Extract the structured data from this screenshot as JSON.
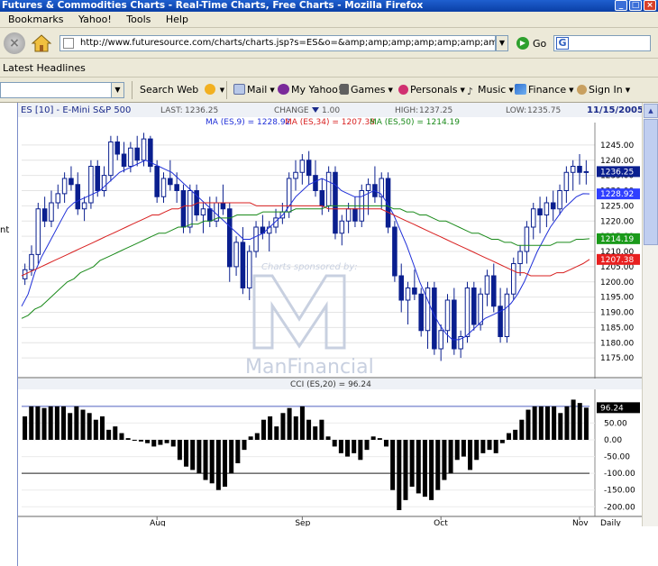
{
  "window": {
    "title": "Futures & Commodities Charts - Real-Time Charts, Free Charts - Mozilla Firefox"
  },
  "menu": [
    "Bookmarks",
    "Yahoo!",
    "Tools",
    "Help"
  ],
  "nav": {
    "url": "http://www.futuresource.com/charts/charts.jsp?s=ES&o=&amp;amp;amp;amp;amp;amp;amp;amp;amp;a=D&",
    "go_label": "Go"
  },
  "headlines_label": "Latest Headlines",
  "yahoo_toolbar": {
    "search_label": "Search Web",
    "items": [
      "Mail",
      "My Yahoo!",
      "Games",
      "Personals",
      "Music",
      "Finance",
      "Sign In"
    ]
  },
  "left_strip_text": "nt",
  "colors": {
    "candle": "#0a1f8f",
    "ma9": "#1f2fd8",
    "ma34": "#d81f1f",
    "ma50": "#1a8a1a",
    "price_tag_last": "#0a1f8f",
    "price_tag_ma9": "#2f3fff",
    "price_tag_ma34": "#e82020",
    "price_tag_ma50": "#1a9a1a",
    "cci_bar": "#000000"
  },
  "chart_header": {
    "symbol": "ES [10] - E-Mini S&P 500",
    "last_label": "LAST:",
    "last_value": "1236.25",
    "change_label": "CHANGE",
    "change_value": "1.00",
    "high_label": "HIGH:",
    "high_value": "1237.25",
    "low_label": "LOW:",
    "low_value": "1235.75",
    "date": "11/15/2005",
    "ma9_label": "MA (ES,9) = 1228.92",
    "ma34_label": "MA (ES,34) = 1207.38",
    "ma50_label": "MA (ES,50) = 1214.19"
  },
  "watermark": {
    "sponsor_text": "Charts sponsored by:",
    "brand_text": "ManFinancial"
  },
  "price_tags": {
    "last": "1236.25",
    "ma9": "1228.92",
    "ma50": "1214.19",
    "ma34": "1207.38"
  },
  "cci": {
    "label": "CCI (ES,20) = 96.24",
    "value_tag": "96.24",
    "ylim": [
      -210,
      140
    ],
    "ticks": [
      "50.00",
      "0.00",
      "-50.00",
      "-100.00",
      "-150.00",
      "-200.00"
    ],
    "tick_values": [
      50,
      0,
      -50,
      -100,
      -150,
      -200
    ],
    "reference_lines": [
      100,
      -100
    ],
    "values": [
      70,
      100,
      100,
      95,
      100,
      100,
      100,
      80,
      100,
      90,
      80,
      60,
      70,
      30,
      40,
      20,
      5,
      0,
      -5,
      -10,
      -20,
      -15,
      -10,
      -20,
      -60,
      -80,
      -90,
      -100,
      -120,
      -130,
      -150,
      -140,
      -100,
      -70,
      -30,
      10,
      20,
      60,
      70,
      40,
      80,
      95,
      70,
      100,
      60,
      40,
      60,
      10,
      -20,
      -40,
      -50,
      -40,
      -60,
      -30,
      10,
      5,
      -20,
      -150,
      -210,
      -180,
      -140,
      -160,
      -170,
      -180,
      -150,
      -120,
      -100,
      -60,
      -50,
      -90,
      -60,
      -40,
      -30,
      -40,
      -10,
      20,
      30,
      60,
      90,
      100,
      100,
      100,
      100,
      80,
      100,
      120,
      110,
      96
    ]
  },
  "chart_data": {
    "type": "candlestick",
    "title": "ES [10] - E-Mini S&P 500",
    "xlabel": "Daily",
    "x_tick_labels": [
      "Aug",
      "Sep",
      "Oct",
      "Nov"
    ],
    "x_tick_indices": [
      20,
      42,
      63,
      84
    ],
    "ylim": [
      1170,
      1250
    ],
    "y_ticks": [
      1175,
      1180,
      1185,
      1190,
      1195,
      1200,
      1205,
      1210,
      1215,
      1220,
      1225,
      1230,
      1235,
      1240,
      1245
    ],
    "grid": true,
    "series": [
      {
        "name": "ES [10]",
        "type": "candlestick",
        "ohlc": [
          [
            1201,
            1206,
            1199,
            1204
          ],
          [
            1204,
            1212,
            1202,
            1209
          ],
          [
            1209,
            1226,
            1206,
            1224
          ],
          [
            1224,
            1228,
            1218,
            1220
          ],
          [
            1220,
            1230,
            1218,
            1226
          ],
          [
            1226,
            1232,
            1224,
            1229
          ],
          [
            1229,
            1236,
            1226,
            1234
          ],
          [
            1234,
            1238,
            1230,
            1232
          ],
          [
            1232,
            1236,
            1222,
            1224
          ],
          [
            1224,
            1228,
            1220,
            1226
          ],
          [
            1226,
            1240,
            1224,
            1238
          ],
          [
            1238,
            1240,
            1228,
            1230
          ],
          [
            1230,
            1238,
            1228,
            1235
          ],
          [
            1235,
            1248,
            1233,
            1246
          ],
          [
            1246,
            1248,
            1240,
            1242
          ],
          [
            1242,
            1246,
            1236,
            1238
          ],
          [
            1238,
            1246,
            1236,
            1244
          ],
          [
            1244,
            1248,
            1238,
            1240
          ],
          [
            1240,
            1249,
            1238,
            1247
          ],
          [
            1247,
            1248,
            1236,
            1238
          ],
          [
            1238,
            1240,
            1226,
            1228
          ],
          [
            1228,
            1236,
            1226,
            1234
          ],
          [
            1234,
            1240,
            1230,
            1232
          ],
          [
            1232,
            1236,
            1226,
            1230
          ],
          [
            1230,
            1232,
            1216,
            1218
          ],
          [
            1218,
            1232,
            1216,
            1230
          ],
          [
            1230,
            1232,
            1220,
            1222
          ],
          [
            1222,
            1226,
            1216,
            1224
          ],
          [
            1224,
            1228,
            1218,
            1220
          ],
          [
            1220,
            1228,
            1218,
            1226
          ],
          [
            1226,
            1232,
            1222,
            1224
          ],
          [
            1224,
            1226,
            1200,
            1205
          ],
          [
            1205,
            1215,
            1202,
            1213
          ],
          [
            1213,
            1218,
            1196,
            1198
          ],
          [
            1198,
            1212,
            1194,
            1210
          ],
          [
            1210,
            1220,
            1208,
            1218
          ],
          [
            1218,
            1222,
            1214,
            1216
          ],
          [
            1216,
            1220,
            1210,
            1218
          ],
          [
            1218,
            1224,
            1216,
            1221
          ],
          [
            1221,
            1226,
            1219,
            1223
          ],
          [
            1223,
            1236,
            1221,
            1234
          ],
          [
            1234,
            1240,
            1230,
            1236
          ],
          [
            1236,
            1242,
            1232,
            1240
          ],
          [
            1240,
            1243,
            1232,
            1235
          ],
          [
            1235,
            1240,
            1228,
            1230
          ],
          [
            1230,
            1234,
            1222,
            1225
          ],
          [
            1225,
            1238,
            1223,
            1236
          ],
          [
            1236,
            1238,
            1214,
            1216
          ],
          [
            1216,
            1222,
            1212,
            1220
          ],
          [
            1220,
            1226,
            1216,
            1224
          ],
          [
            1224,
            1228,
            1218,
            1220
          ],
          [
            1220,
            1232,
            1218,
            1230
          ],
          [
            1230,
            1234,
            1222,
            1232
          ],
          [
            1232,
            1238,
            1226,
            1228
          ],
          [
            1228,
            1236,
            1224,
            1234
          ],
          [
            1234,
            1236,
            1216,
            1218
          ],
          [
            1218,
            1220,
            1200,
            1202
          ],
          [
            1202,
            1206,
            1190,
            1194
          ],
          [
            1194,
            1200,
            1186,
            1198
          ],
          [
            1198,
            1204,
            1194,
            1196
          ],
          [
            1196,
            1198,
            1182,
            1184
          ],
          [
            1184,
            1200,
            1178,
            1198
          ],
          [
            1198,
            1200,
            1176,
            1178
          ],
          [
            1178,
            1186,
            1174,
            1184
          ],
          [
            1184,
            1196,
            1180,
            1194
          ],
          [
            1194,
            1198,
            1176,
            1178
          ],
          [
            1178,
            1184,
            1175,
            1182
          ],
          [
            1182,
            1200,
            1180,
            1198
          ],
          [
            1198,
            1200,
            1184,
            1186
          ],
          [
            1186,
            1198,
            1184,
            1196
          ],
          [
            1196,
            1204,
            1192,
            1202
          ],
          [
            1202,
            1206,
            1190,
            1192
          ],
          [
            1192,
            1198,
            1180,
            1182
          ],
          [
            1182,
            1198,
            1180,
            1196
          ],
          [
            1196,
            1208,
            1194,
            1206
          ],
          [
            1206,
            1212,
            1202,
            1210
          ],
          [
            1210,
            1220,
            1206,
            1218
          ],
          [
            1218,
            1226,
            1214,
            1224
          ],
          [
            1224,
            1228,
            1216,
            1222
          ],
          [
            1222,
            1228,
            1218,
            1226
          ],
          [
            1226,
            1230,
            1220,
            1224
          ],
          [
            1224,
            1232,
            1222,
            1230
          ],
          [
            1230,
            1238,
            1226,
            1236
          ],
          [
            1236,
            1240,
            1230,
            1238
          ],
          [
            1238,
            1242,
            1232,
            1236
          ],
          [
            1236,
            1240,
            1232,
            1236.25
          ]
        ]
      },
      {
        "name": "MA (ES,9)",
        "type": "line",
        "values": [
          1192,
          1196,
          1203,
          1208,
          1212,
          1216,
          1220,
          1224,
          1226,
          1227,
          1228,
          1229,
          1230,
          1232,
          1234,
          1236,
          1237,
          1238,
          1239,
          1240,
          1239,
          1238,
          1237,
          1236,
          1234,
          1232,
          1230,
          1228,
          1226,
          1224,
          1222,
          1220,
          1218,
          1216,
          1214,
          1214,
          1215,
          1216,
          1218,
          1220,
          1222,
          1225,
          1228,
          1230,
          1232,
          1233,
          1234,
          1233,
          1232,
          1230,
          1229,
          1228,
          1228,
          1229,
          1230,
          1229,
          1226,
          1222,
          1217,
          1212,
          1206,
          1200,
          1195,
          1190,
          1186,
          1183,
          1181,
          1181,
          1182,
          1184,
          1186,
          1188,
          1189,
          1190,
          1191,
          1193,
          1196,
          1200,
          1205,
          1210,
          1214,
          1218,
          1221,
          1224,
          1226,
          1228,
          1229,
          1228.92
        ]
      },
      {
        "name": "MA (ES,34)",
        "type": "line",
        "values": [
          1202,
          1203,
          1204,
          1205,
          1206,
          1207,
          1208,
          1209,
          1210,
          1211,
          1212,
          1213,
          1214,
          1215,
          1216,
          1217,
          1218,
          1219,
          1220,
          1221,
          1222,
          1222,
          1223,
          1224,
          1224,
          1225,
          1225,
          1226,
          1226,
          1226,
          1226,
          1226,
          1226,
          1226,
          1226,
          1226,
          1225,
          1225,
          1225,
          1225,
          1225,
          1225,
          1225,
          1225,
          1225,
          1225,
          1225,
          1224,
          1224,
          1224,
          1224,
          1224,
          1224,
          1224,
          1224,
          1224,
          1223,
          1222,
          1221,
          1220,
          1219,
          1218,
          1217,
          1216,
          1215,
          1214,
          1213,
          1212,
          1211,
          1210,
          1209,
          1208,
          1207,
          1206,
          1205,
          1204,
          1203,
          1203,
          1202,
          1202,
          1202,
          1202,
          1203,
          1203,
          1204,
          1205,
          1206,
          1207.38
        ]
      },
      {
        "name": "MA (ES,50)",
        "type": "line",
        "values": [
          1188,
          1189,
          1191,
          1192,
          1194,
          1196,
          1198,
          1200,
          1201,
          1203,
          1204,
          1205,
          1207,
          1208,
          1209,
          1210,
          1211,
          1212,
          1213,
          1214,
          1215,
          1216,
          1216,
          1217,
          1218,
          1218,
          1219,
          1219,
          1220,
          1220,
          1221,
          1221,
          1221,
          1222,
          1222,
          1222,
          1222,
          1223,
          1223,
          1223,
          1223,
          1223,
          1224,
          1224,
          1224,
          1224,
          1224,
          1225,
          1225,
          1225,
          1225,
          1225,
          1225,
          1225,
          1225,
          1225,
          1225,
          1224,
          1224,
          1223,
          1223,
          1222,
          1222,
          1221,
          1220,
          1220,
          1219,
          1218,
          1217,
          1216,
          1216,
          1215,
          1214,
          1214,
          1213,
          1213,
          1212,
          1212,
          1212,
          1212,
          1212,
          1212,
          1213,
          1213,
          1213,
          1214,
          1214,
          1214.19
        ]
      }
    ]
  }
}
